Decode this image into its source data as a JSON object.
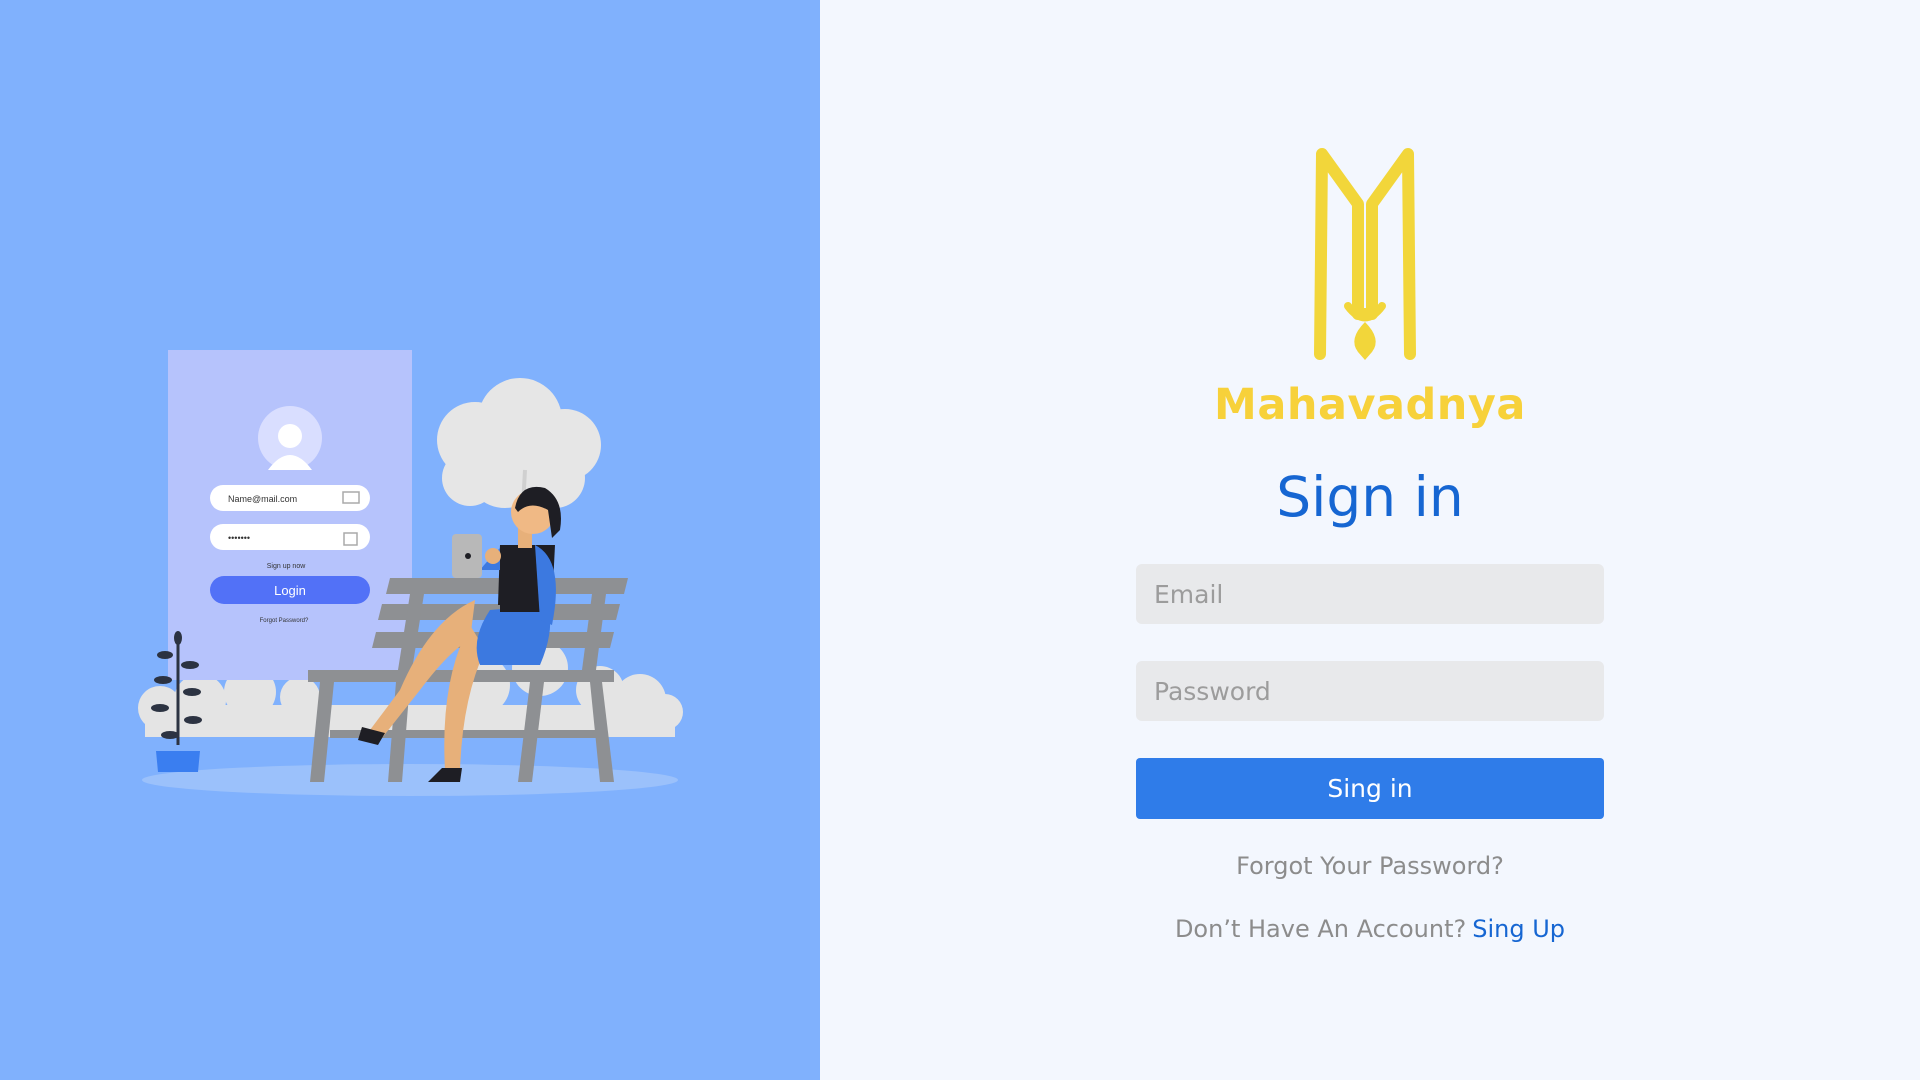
{
  "brand": {
    "name": "Mahavadnya"
  },
  "signin": {
    "heading": "Sign in",
    "email_placeholder": "Email",
    "password_placeholder": "Password",
    "submit_label": "Sing in",
    "forgot_label": "Forgot Your Password?",
    "no_account_text": "Don’t Have An Account?",
    "signup_label": "Sing Up"
  },
  "illustration": {
    "card_email": "Name@mail.com",
    "card_password": "•••••••",
    "card_signup": "Sign up now",
    "card_login": "Login",
    "card_forgot": "Forgot Password?"
  },
  "colors": {
    "left_panel": "#80b1fd",
    "right_panel": "#f3f7fe",
    "brand": "#f7d13a",
    "heading": "#1666d2",
    "button": "#2f7ce9",
    "input_bg": "#e8e9eb",
    "muted_text": "#8c8c8c"
  }
}
